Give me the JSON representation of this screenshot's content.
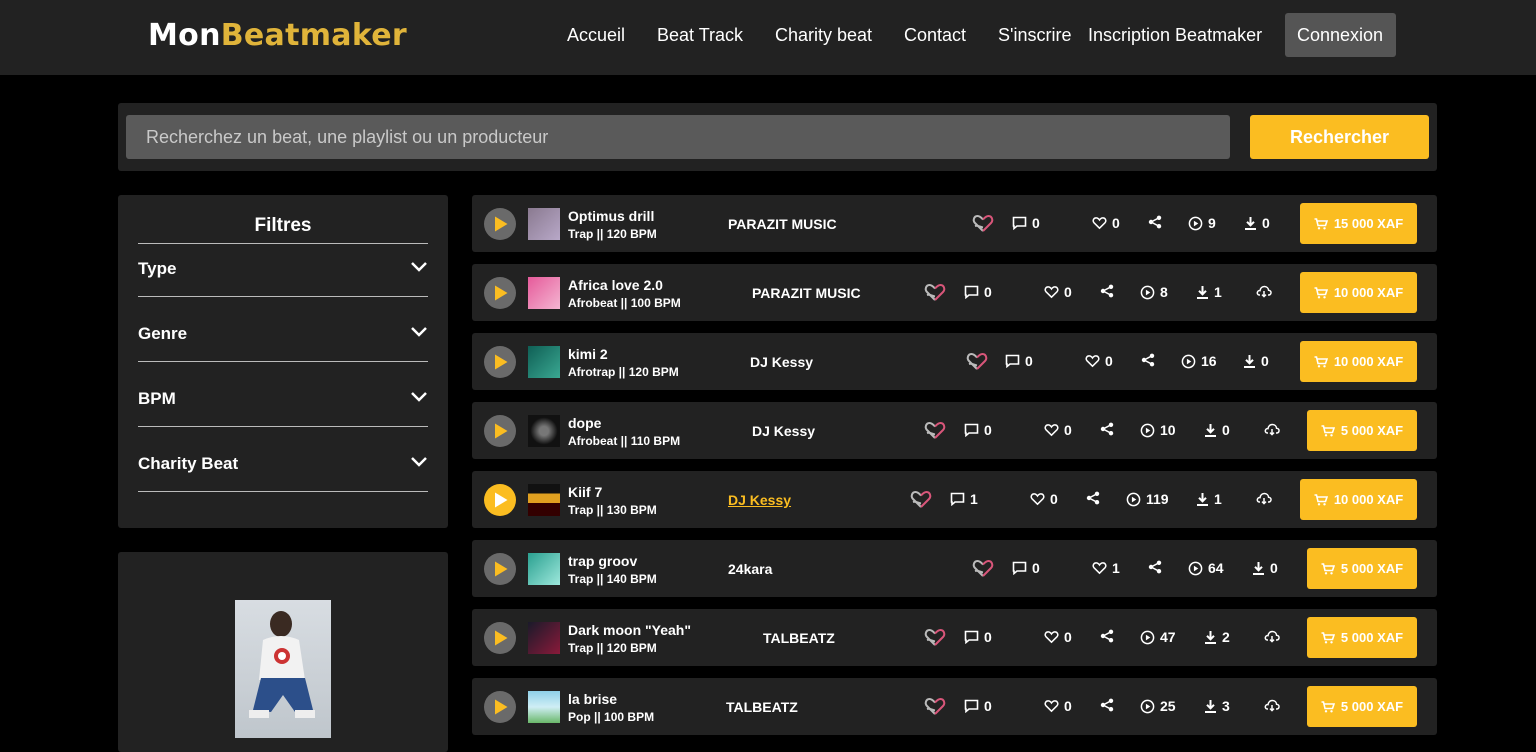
{
  "header": {
    "logo_part1": "Mon",
    "logo_part2": "Beatmaker",
    "nav": [
      "Accueil",
      "Beat Track",
      "Charity beat",
      "Contact",
      "S'inscrire",
      "Inscription Beatmaker"
    ],
    "login": "Connexion"
  },
  "search": {
    "placeholder": "Recherchez un beat, une playlist ou un producteur",
    "button": "Rechercher"
  },
  "filters": {
    "title": "Filtres",
    "items": [
      "Type",
      "Genre",
      "BPM",
      "Charity Beat"
    ]
  },
  "colors": {
    "accent": "#fbbd21",
    "logo_yellow": "#e0b43a",
    "panel": "#222222"
  },
  "tracks": [
    {
      "name": "Optimus drill",
      "meta": "Trap || 120 BPM",
      "producer": "PARAZIT MUSIC",
      "comments": "0",
      "likes": "0",
      "plays": "9",
      "downloads": "0",
      "price": "15 000 XAF",
      "active": false,
      "linked": false,
      "has_cloud": false
    },
    {
      "name": "Africa love 2.0",
      "meta": "Afrobeat || 100 BPM",
      "producer": "PARAZIT MUSIC",
      "comments": "0",
      "likes": "0",
      "plays": "8",
      "downloads": "1",
      "price": "10 000 XAF",
      "active": false,
      "linked": false,
      "has_cloud": true
    },
    {
      "name": "kimi 2",
      "meta": "Afrotrap || 120 BPM",
      "producer": "DJ Kessy",
      "comments": "0",
      "likes": "0",
      "plays": "16",
      "downloads": "0",
      "price": "10 000 XAF",
      "active": false,
      "linked": false,
      "has_cloud": false
    },
    {
      "name": "dope",
      "meta": "Afrobeat || 110 BPM",
      "producer": "DJ Kessy",
      "comments": "0",
      "likes": "0",
      "plays": "10",
      "downloads": "0",
      "price": "5 000 XAF",
      "active": false,
      "linked": false,
      "has_cloud": true
    },
    {
      "name": "Kiif 7",
      "meta": "Trap || 130 BPM",
      "producer": "DJ Kessy",
      "comments": "1",
      "likes": "0",
      "plays": "119",
      "downloads": "1",
      "price": "10 000 XAF",
      "active": true,
      "linked": true,
      "has_cloud": true
    },
    {
      "name": "trap groov",
      "meta": "Trap || 140 BPM",
      "producer": "24kara",
      "comments": "0",
      "likes": "1",
      "plays": "64",
      "downloads": "0",
      "price": "5 000 XAF",
      "active": false,
      "linked": false,
      "has_cloud": false
    },
    {
      "name": "Dark moon \"Yeah\"",
      "meta": "Trap || 120 BPM",
      "producer": "TALBEATZ",
      "comments": "0",
      "likes": "0",
      "plays": "47",
      "downloads": "2",
      "price": "5 000 XAF",
      "active": false,
      "linked": false,
      "has_cloud": true
    },
    {
      "name": "la brise",
      "meta": "Pop || 100 BPM",
      "producer": "TALBEATZ",
      "comments": "0",
      "likes": "0",
      "plays": "25",
      "downloads": "3",
      "price": "5 000 XAF",
      "active": false,
      "linked": false,
      "has_cloud": true
    }
  ]
}
